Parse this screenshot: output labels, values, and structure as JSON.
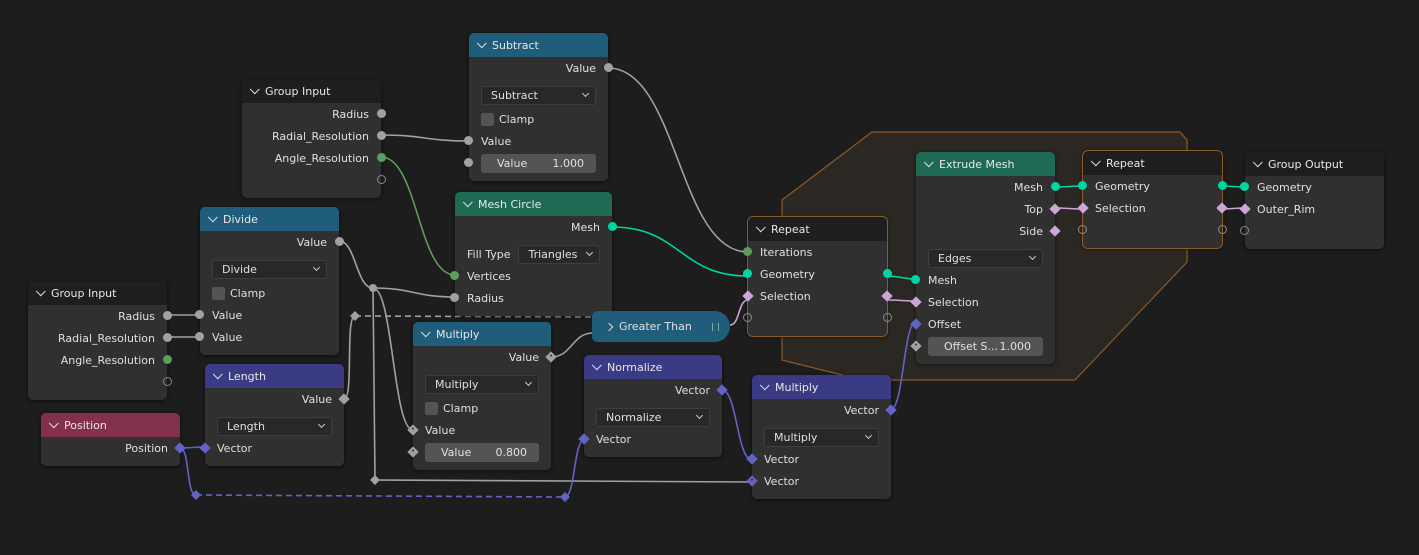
{
  "colors": {
    "background": "#1d1d1d",
    "node_body": "#303030",
    "header_group": "#1e1e1e",
    "header_math": "#1f5d7a",
    "header_geometry": "#1f6a54",
    "header_vector": "#3b3b85",
    "header_input": "#83314a",
    "zone_fill": "#2b2723",
    "zone_border": "#8a5a2a",
    "socket_float": "#a1a1a1",
    "socket_int": "#5e9e5a",
    "socket_geometry": "#00d6a3",
    "socket_vector": "#6363c7",
    "socket_bool": "#cca6d6"
  },
  "nodes": {
    "gi_a": {
      "title": "Group Input",
      "header": "group",
      "rows": [
        {
          "type": "output",
          "label": "Radius",
          "socket": "float",
          "shape": "circle"
        },
        {
          "type": "output",
          "label": "Radial_Resolution",
          "socket": "float",
          "shape": "circle"
        },
        {
          "type": "output",
          "label": "Angle_Resolution",
          "socket": "int",
          "shape": "circle"
        },
        {
          "type": "output",
          "label": "",
          "socket": "empty",
          "shape": "circle"
        }
      ]
    },
    "subtract": {
      "title": "Subtract",
      "header": "math",
      "rows": [
        {
          "type": "output",
          "label": "Value",
          "socket": "float",
          "shape": "circle"
        },
        {
          "type": "dropdown",
          "value": "Subtract"
        },
        {
          "type": "checkbox",
          "label": "Clamp",
          "checked": false
        },
        {
          "type": "input",
          "label": "Value",
          "socket": "float",
          "shape": "circle"
        },
        {
          "type": "field",
          "label": "Value",
          "value": "1.000",
          "socket": "float",
          "shape": "circle"
        }
      ]
    },
    "divide": {
      "title": "Divide",
      "header": "math",
      "rows": [
        {
          "type": "output",
          "label": "Value",
          "socket": "float",
          "shape": "circle"
        },
        {
          "type": "dropdown",
          "value": "Divide"
        },
        {
          "type": "checkbox",
          "label": "Clamp",
          "checked": false
        },
        {
          "type": "input",
          "label": "Value",
          "socket": "float",
          "shape": "circle"
        },
        {
          "type": "input",
          "label": "Value",
          "socket": "float",
          "shape": "circle"
        }
      ]
    },
    "gi_b": {
      "title": "Group Input",
      "header": "group",
      "rows": [
        {
          "type": "output",
          "label": "Radius",
          "socket": "float",
          "shape": "circle"
        },
        {
          "type": "output",
          "label": "Radial_Resolution",
          "socket": "float",
          "shape": "circle"
        },
        {
          "type": "output",
          "label": "Angle_Resolution",
          "socket": "int",
          "shape": "circle"
        },
        {
          "type": "output",
          "label": "",
          "socket": "empty",
          "shape": "circle"
        }
      ]
    },
    "mesh_circle": {
      "title": "Mesh Circle",
      "header": "geometry",
      "rows": [
        {
          "type": "output",
          "label": "Mesh",
          "socket": "geometry",
          "shape": "circle"
        },
        {
          "type": "dropdown",
          "label": "Fill Type",
          "value": "Triangles"
        },
        {
          "type": "input",
          "label": "Vertices",
          "socket": "int",
          "shape": "circle"
        },
        {
          "type": "input",
          "label": "Radius",
          "socket": "float",
          "shape": "circle"
        }
      ]
    },
    "length": {
      "title": "Length",
      "header": "vector",
      "rows": [
        {
          "type": "output",
          "label": "Value",
          "socket": "float",
          "shape": "diamond"
        },
        {
          "type": "dropdown",
          "value": "Length"
        },
        {
          "type": "input",
          "label": "Vector",
          "socket": "vector",
          "shape": "diamond"
        }
      ]
    },
    "position": {
      "title": "Position",
      "header": "input",
      "rows": [
        {
          "type": "output",
          "label": "Position",
          "socket": "vector",
          "shape": "diamond"
        }
      ]
    },
    "multiply_math": {
      "title": "Multiply",
      "header": "math",
      "rows": [
        {
          "type": "output",
          "label": "Value",
          "socket": "float",
          "shape": "diamond-dot"
        },
        {
          "type": "dropdown",
          "value": "Multiply"
        },
        {
          "type": "checkbox",
          "label": "Clamp",
          "checked": false
        },
        {
          "type": "input",
          "label": "Value",
          "socket": "float",
          "shape": "diamond-dot"
        },
        {
          "type": "field",
          "label": "Value",
          "value": "0.800",
          "socket": "float",
          "shape": "diamond-dot"
        }
      ]
    },
    "normalize": {
      "title": "Normalize",
      "header": "vector",
      "rows": [
        {
          "type": "output",
          "label": "Vector",
          "socket": "vector",
          "shape": "diamond"
        },
        {
          "type": "dropdown",
          "value": "Normalize"
        },
        {
          "type": "input",
          "label": "Vector",
          "socket": "vector",
          "shape": "diamond"
        }
      ]
    },
    "repeat_in": {
      "title": "Repeat",
      "header": "group",
      "zone": true,
      "rows": [
        {
          "type": "input",
          "label": "Iterations",
          "socket": "int",
          "shape": "circle"
        },
        {
          "type": "both",
          "label": "Geometry",
          "socket": "geometry",
          "shape": "circle"
        },
        {
          "type": "both",
          "label": "Selection",
          "socket": "bool",
          "shape": "diamond"
        },
        {
          "type": "both",
          "label": "",
          "socket": "empty",
          "shape": "circle"
        }
      ]
    },
    "extrude": {
      "title": "Extrude Mesh",
      "header": "geometry",
      "rows": [
        {
          "type": "output",
          "label": "Mesh",
          "socket": "geometry",
          "shape": "circle"
        },
        {
          "type": "output",
          "label": "Top",
          "socket": "bool",
          "shape": "diamond"
        },
        {
          "type": "output",
          "label": "Side",
          "socket": "bool",
          "shape": "diamond"
        },
        {
          "type": "dropdown",
          "value": "Edges"
        },
        {
          "type": "input",
          "label": "Mesh",
          "socket": "geometry",
          "shape": "circle"
        },
        {
          "type": "input",
          "label": "Selection",
          "socket": "bool",
          "shape": "diamond"
        },
        {
          "type": "input",
          "label": "Offset",
          "socket": "vector",
          "shape": "diamond"
        },
        {
          "type": "field",
          "label": "Offset S...",
          "value": "1.000",
          "socket": "float",
          "shape": "diamond-dot"
        }
      ]
    },
    "repeat_out": {
      "title": "Repeat",
      "header": "group",
      "zone": true,
      "rows": [
        {
          "type": "both",
          "label": "Geometry",
          "socket": "geometry",
          "shape": "circle"
        },
        {
          "type": "both",
          "label": "Selection",
          "socket": "bool",
          "shape": "diamond"
        },
        {
          "type": "both",
          "label": "",
          "socket": "empty",
          "shape": "circle"
        }
      ]
    },
    "group_output": {
      "title": "Group Output",
      "header": "group",
      "rows": [
        {
          "type": "input",
          "label": "Geometry",
          "socket": "geometry",
          "shape": "circle"
        },
        {
          "type": "input",
          "label": "Outer_Rim",
          "socket": "bool",
          "shape": "diamond"
        },
        {
          "type": "input",
          "label": "",
          "socket": "empty",
          "shape": "circle"
        }
      ]
    },
    "multiply_vec": {
      "title": "Multiply",
      "header": "vector",
      "rows": [
        {
          "type": "output",
          "label": "Vector",
          "socket": "vector",
          "shape": "diamond"
        },
        {
          "type": "dropdown",
          "value": "Multiply"
        },
        {
          "type": "input",
          "label": "Vector",
          "socket": "vector",
          "shape": "diamond"
        },
        {
          "type": "input",
          "label": "Vector",
          "socket": "vector",
          "shape": "diamond-dot"
        }
      ]
    }
  },
  "collapsed_node": {
    "title": "Greater Than",
    "header": "math"
  }
}
